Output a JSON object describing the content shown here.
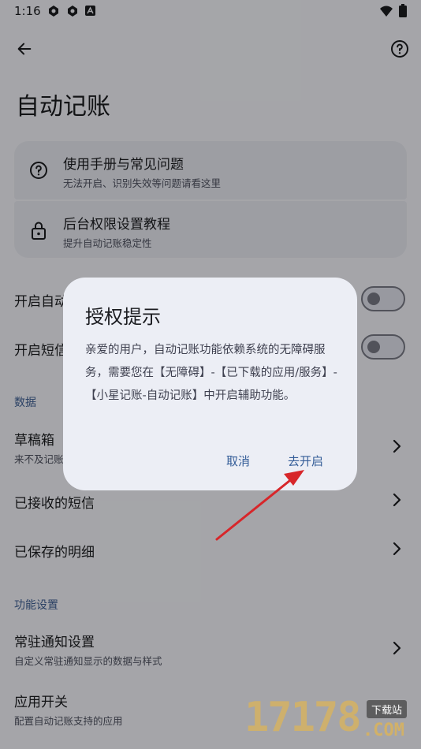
{
  "status_bar": {
    "time": "1:16"
  },
  "header": {
    "title": "自动记账"
  },
  "help_card": {
    "items": [
      {
        "title": "使用手册与常见问题",
        "subtitle": "无法开启、识别失效等问题请看这里"
      },
      {
        "title": "后台权限设置教程",
        "subtitle": "提升自动记账稳定性"
      }
    ]
  },
  "toggles": [
    {
      "label": "开启自动",
      "on": false
    },
    {
      "label": "开启短信",
      "on": false
    }
  ],
  "data_section": {
    "heading": "数据",
    "items": [
      {
        "title": "草稿箱",
        "subtitle": "来不及记账"
      },
      {
        "title": "已接收的短信"
      },
      {
        "title": "已保存的明细"
      }
    ]
  },
  "feature_section": {
    "heading": "功能设置",
    "items": [
      {
        "title": "常驻通知设置",
        "subtitle": "自定义常驻通知显示的数据与样式"
      },
      {
        "title": "应用开关",
        "subtitle": "配置自动记账支持的应用"
      }
    ]
  },
  "dialog": {
    "title": "授权提示",
    "body": "亲爱的用户，自动记账功能依赖系统的无障碍服务，需要您在【无障碍】-【已下载的应用/服务】-【小星记账-自动记账】中开启辅助功能。",
    "cancel_label": "取消",
    "confirm_label": "去开启"
  },
  "watermark": {
    "number": "17178",
    "domain": ".COM",
    "tag": "下载站"
  },
  "colors": {
    "accent": "#345d98",
    "section": "#3f5f94",
    "annotation_arrow": "#d7262a"
  }
}
